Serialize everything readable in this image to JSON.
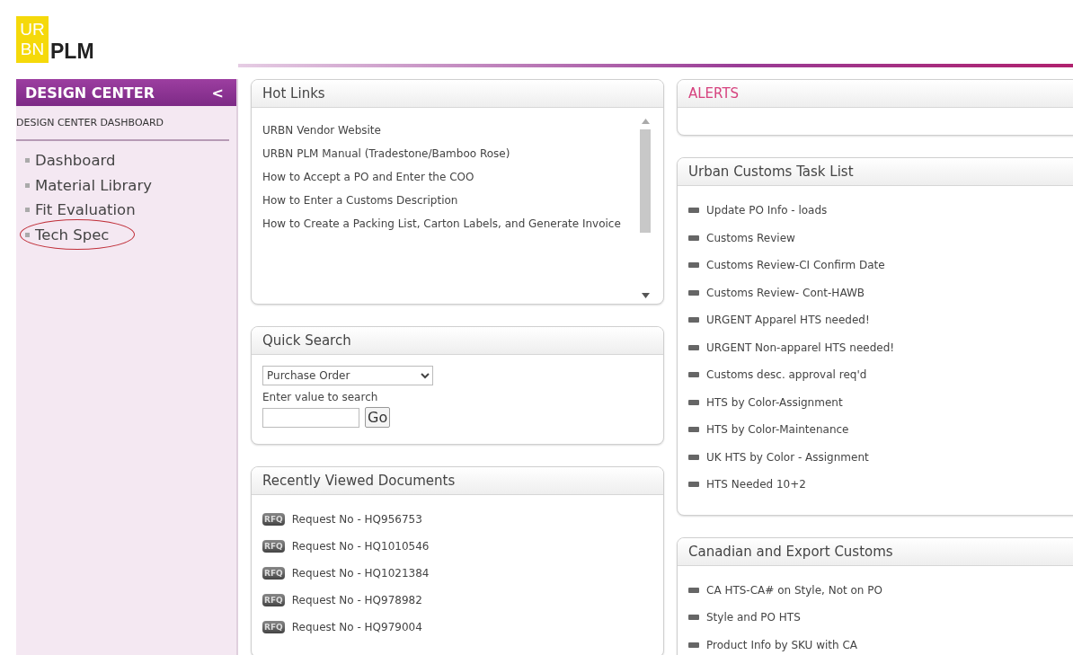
{
  "logo": {
    "top": "UR",
    "bottom": "BN",
    "name": "PLM"
  },
  "sidebar": {
    "title": "DESIGN CENTER",
    "collapse": "<",
    "section": "DESIGN CENTER DASHBOARD",
    "items": [
      {
        "label": "Dashboard",
        "circled": false
      },
      {
        "label": "Material Library",
        "circled": false
      },
      {
        "label": "Fit Evaluation",
        "circled": false
      },
      {
        "label": "Tech Spec",
        "circled": true
      }
    ]
  },
  "hot_links": {
    "title": "Hot Links",
    "links": [
      "URBN Vendor Website",
      "URBN PLM Manual (Tradestone/Bamboo Rose)",
      "How to Accept a PO and Enter the COO",
      "How to Enter a Customs Description",
      "How to Create a Packing List, Carton Labels, and Generate Invoice"
    ]
  },
  "quick_search": {
    "title": "Quick Search",
    "select": "Purchase Order",
    "label": "Enter value to search",
    "button": "Go"
  },
  "recent": {
    "title": "Recently Viewed Documents",
    "items": [
      {
        "badge": "RFQ",
        "text": "Request No - HQ956753"
      },
      {
        "badge": "RFQ",
        "text": "Request No - HQ1010546"
      },
      {
        "badge": "RFQ",
        "text": "Request No - HQ1021384"
      },
      {
        "badge": "RFQ",
        "text": "Request No - HQ978982"
      },
      {
        "badge": "RFQ",
        "text": "Request No - HQ979004"
      }
    ]
  },
  "alerts": {
    "title": "ALERTS"
  },
  "task_list": {
    "title": "Urban Customs Task List",
    "items": [
      "Update PO Info - loads",
      "Customs Review",
      "Customs Review-CI Confirm Date",
      "Customs Review- Cont-HAWB",
      "URGENT Apparel HTS needed!",
      "URGENT Non-apparel HTS needed!",
      "Customs desc. approval req'd",
      "HTS by Color-Assignment",
      "HTS by Color-Maintenance",
      "UK HTS by Color - Assignment",
      "HTS Needed 10+2"
    ]
  },
  "canadian": {
    "title": "Canadian and Export Customs",
    "items": [
      "CA HTS-CA# on Style, Not on PO",
      "Style and PO HTS",
      "Product Info by SKU with CA"
    ]
  }
}
